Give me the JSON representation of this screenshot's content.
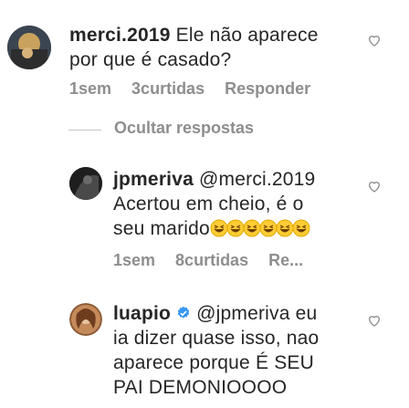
{
  "comments": [
    {
      "username": "merci.2019",
      "line1": "Ele não aparece",
      "line2": "por que é casado?",
      "time": "1sem",
      "likes": "3curtidas",
      "reply": "Responder"
    },
    {
      "username": "jpmeriva",
      "mention": "@merci.2019",
      "line1": "Acertou em cheio, é o",
      "line2": "seu marido",
      "time": "1sem",
      "likes": "8curtidas",
      "reply": "Re..."
    },
    {
      "username": "luapio",
      "mention": "@jpmeriva",
      "line1_tail": "eu",
      "line2": "ia dizer quase isso, nao",
      "line3": "aparece porque É SEU",
      "line4": "PAI DEMONIOOOO"
    }
  ],
  "hide_replies": "Ocultar respostas",
  "colors": {
    "mention": "#262626",
    "verified": "#3897f0",
    "meta": "#8e8e8e"
  },
  "icons": {
    "like": "heart-outline-icon",
    "verified": "verified-badge-icon",
    "emoji": "grinning-squinting-emoji-icon"
  }
}
